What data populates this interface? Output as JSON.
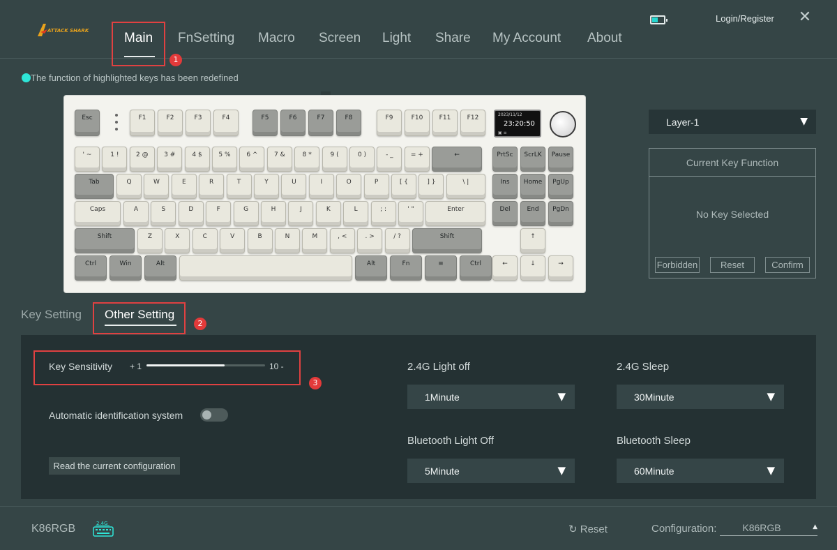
{
  "header": {
    "logo_text": "ATTACK SHARK",
    "nav": [
      "Main",
      "FnSetting",
      "Macro",
      "Screen",
      "Light",
      "Share",
      "My Account",
      "About"
    ],
    "active_nav": "Main",
    "login": "Login/Register",
    "battery_icon": "battery-icon",
    "close_icon": "close-icon"
  },
  "badges": [
    "1",
    "2",
    "3"
  ],
  "info_text": "The function of highlighted keys has been redefined",
  "keyboard": {
    "screen_date": "2023/11/12",
    "screen_time": "23:20:50",
    "screen_status": "▣ ≡",
    "row_fn": [
      "Esc",
      "F1",
      "F2",
      "F3",
      "F4",
      "F5",
      "F6",
      "F7",
      "F8",
      "F9",
      "F10",
      "F11",
      "F12"
    ],
    "row_num": [
      "' ~",
      "1 !",
      "2 @",
      "3 #",
      "4 $",
      "5 %",
      "6 ^",
      "7 &",
      "8 *",
      "9 (",
      "0 )",
      "- _",
      "= +",
      "←",
      "PrtSc",
      "ScrLK",
      "Pause"
    ],
    "row_q": [
      "Tab",
      "Q",
      "W",
      "E",
      "R",
      "T",
      "Y",
      "U",
      "I",
      "O",
      "P",
      "[ {",
      "] }",
      "\\ |",
      "Ins",
      "Home",
      "PgUp"
    ],
    "row_a": [
      "Caps",
      "A",
      "S",
      "D",
      "F",
      "G",
      "H",
      "J",
      "K",
      "L",
      "; :",
      "' \"",
      "Enter",
      "Del",
      "End",
      "PgDn"
    ],
    "row_z": [
      "Shift",
      "Z",
      "X",
      "C",
      "V",
      "B",
      "N",
      "M",
      ", <",
      ". >",
      "/ ?",
      "Shift",
      "↑"
    ],
    "row_b": [
      "Ctrl",
      "Win",
      "Alt",
      "",
      "Alt",
      "Fn",
      "≡",
      "Ctrl",
      "←",
      "↓",
      "→"
    ]
  },
  "layer": {
    "value": "Layer-1",
    "caret": "▼"
  },
  "key_function": {
    "title": "Current Key Function",
    "empty": "No Key Selected",
    "buttons": [
      "Forbidden",
      "Reset",
      "Confirm"
    ]
  },
  "tabs": [
    "Key Setting",
    "Other Setting"
  ],
  "settings": {
    "sensitivity_label": "Key Sensitivity",
    "sensitivity_plus": "+ 1",
    "sensitivity_minus": "10 -",
    "sensitivity_level": 0.66,
    "auto_label": "Automatic identification system",
    "auto_on": false,
    "read_button": "Read the current configuration",
    "light_off_24_label": "2.4G Light off",
    "light_off_24_value": "1Minute",
    "sleep_24_label": "2.4G Sleep",
    "sleep_24_value": "30Minute",
    "bt_light_label": "Bluetooth Light Off",
    "bt_light_value": "5Minute",
    "bt_sleep_label": "Bluetooth Sleep",
    "bt_sleep_value": "60Minute",
    "caret": "▼"
  },
  "footer": {
    "model": "K86RGB",
    "mode_badge": "2.4G",
    "reset": "Reset",
    "config_label": "Configuration:",
    "config_value": "K86RGB",
    "config_caret": "▲"
  },
  "colors": {
    "background": "#354546",
    "panel": "#243133",
    "accent": "#2ee6d8",
    "highlight_box": "#e04141"
  }
}
